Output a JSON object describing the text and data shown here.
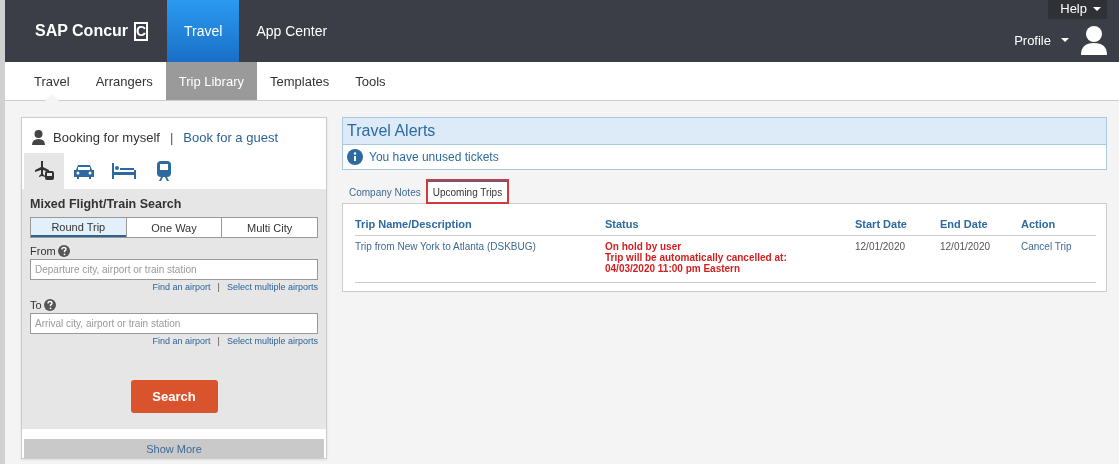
{
  "header": {
    "brand": "SAP Concur",
    "brand_mark": "C",
    "nav": [
      {
        "label": "Travel",
        "selected": true
      },
      {
        "label": "App Center",
        "selected": false
      }
    ],
    "help": "Help",
    "profile": "Profile"
  },
  "subnav": [
    {
      "label": "Travel",
      "selected": false,
      "current": true
    },
    {
      "label": "Arrangers",
      "selected": false,
      "current": false
    },
    {
      "label": "Trip Library",
      "selected": true,
      "current": false
    },
    {
      "label": "Templates",
      "selected": false,
      "current": false
    },
    {
      "label": "Tools",
      "selected": false,
      "current": false
    }
  ],
  "booking": {
    "for_self": "Booking for myself",
    "separator": "|",
    "guest_link": "Book for a guest",
    "modes": [
      {
        "kind": "flight-train",
        "selected": true
      },
      {
        "kind": "car",
        "selected": false
      },
      {
        "kind": "hotel",
        "selected": false
      },
      {
        "kind": "rail",
        "selected": false
      }
    ],
    "title": "Mixed Flight/Train Search",
    "trip_types": [
      {
        "label": "Round Trip",
        "selected": true
      },
      {
        "label": "One Way",
        "selected": false
      },
      {
        "label": "Multi City",
        "selected": false
      }
    ],
    "fields": [
      {
        "label": "From",
        "placeholder": "Departure city, airport or train station",
        "find_link": "Find an airport",
        "separator": "|",
        "multi_link": "Select multiple airports"
      },
      {
        "label": "To",
        "placeholder": "Arrival city, airport or train station",
        "find_link": "Find an airport",
        "separator": "|",
        "multi_link": "Select multiple airports"
      }
    ],
    "search_button": "Search",
    "show_more": "Show More"
  },
  "alerts": {
    "title": "Travel Alerts",
    "message": "You have unused tickets"
  },
  "trip_tabs": [
    {
      "label": "Company Notes",
      "selected": false,
      "highlighted": false
    },
    {
      "label": "Upcoming Trips",
      "selected": true,
      "highlighted": true
    }
  ],
  "table": {
    "columns": [
      "Trip Name/Description",
      "Status",
      "Start Date",
      "End Date",
      "Action"
    ],
    "rows": [
      {
        "name": "Trip from New York to Atlanta (DSKBUG)",
        "status": [
          "On hold by user",
          "Trip will be automatically cancelled at:",
          "04/03/2020 11:00 pm Eastern"
        ],
        "start": "12/01/2020",
        "end": "12/01/2020",
        "action": "Cancel Trip"
      }
    ]
  }
}
